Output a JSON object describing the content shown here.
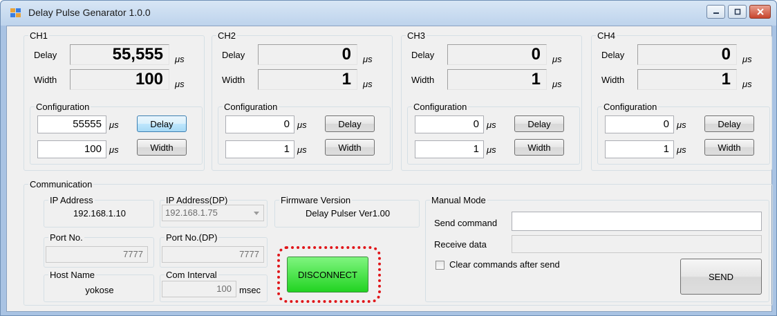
{
  "window": {
    "title": "Delay Pulse Genarator 1.0.0"
  },
  "channels": [
    {
      "name": "CH1",
      "delay_label": "Delay",
      "width_label": "Width",
      "delay_value": "55,555",
      "width_value": "100",
      "unit": "μs",
      "config_label": "Configuration",
      "config_delay": "55555",
      "config_width": "100",
      "delay_button": "Delay",
      "width_button": "Width"
    },
    {
      "name": "CH2",
      "delay_label": "Delay",
      "width_label": "Width",
      "delay_value": "0",
      "width_value": "1",
      "unit": "μs",
      "config_label": "Configuration",
      "config_delay": "0",
      "config_width": "1",
      "delay_button": "Delay",
      "width_button": "Width"
    },
    {
      "name": "CH3",
      "delay_label": "Delay",
      "width_label": "Width",
      "delay_value": "0",
      "width_value": "1",
      "unit": "μs",
      "config_label": "Configuration",
      "config_delay": "0",
      "config_width": "1",
      "delay_button": "Delay",
      "width_button": "Width"
    },
    {
      "name": "CH4",
      "delay_label": "Delay",
      "width_label": "Width",
      "delay_value": "0",
      "width_value": "1",
      "unit": "μs",
      "config_label": "Configuration",
      "config_delay": "0",
      "config_width": "1",
      "delay_button": "Delay",
      "width_button": "Width"
    }
  ],
  "communication": {
    "label": "Communication",
    "ip_address_label": "IP Address",
    "ip_address_value": "192.168.1.10",
    "ip_dp_label": "IP Address(DP)",
    "ip_dp_value": "192.168.1.75",
    "firmware_label": "Firmware Version",
    "firmware_value": "Delay Pulser Ver1.00",
    "port_label": "Port No.",
    "port_value": "7777",
    "port_dp_label": "Port No.(DP)",
    "port_dp_value": "7777",
    "host_label": "Host Name",
    "host_value": "yokose",
    "interval_label": "Com Interval",
    "interval_value": "100",
    "interval_unit": "msec",
    "disconnect_button": "DISCONNECT"
  },
  "manual_mode": {
    "label": "Manual Mode",
    "send_command_label": "Send command",
    "send_command_value": "",
    "receive_data_label": "Receive data",
    "receive_data_value": "",
    "clear_checkbox_label": "Clear commands after send",
    "clear_checked": false,
    "send_button": "SEND"
  }
}
